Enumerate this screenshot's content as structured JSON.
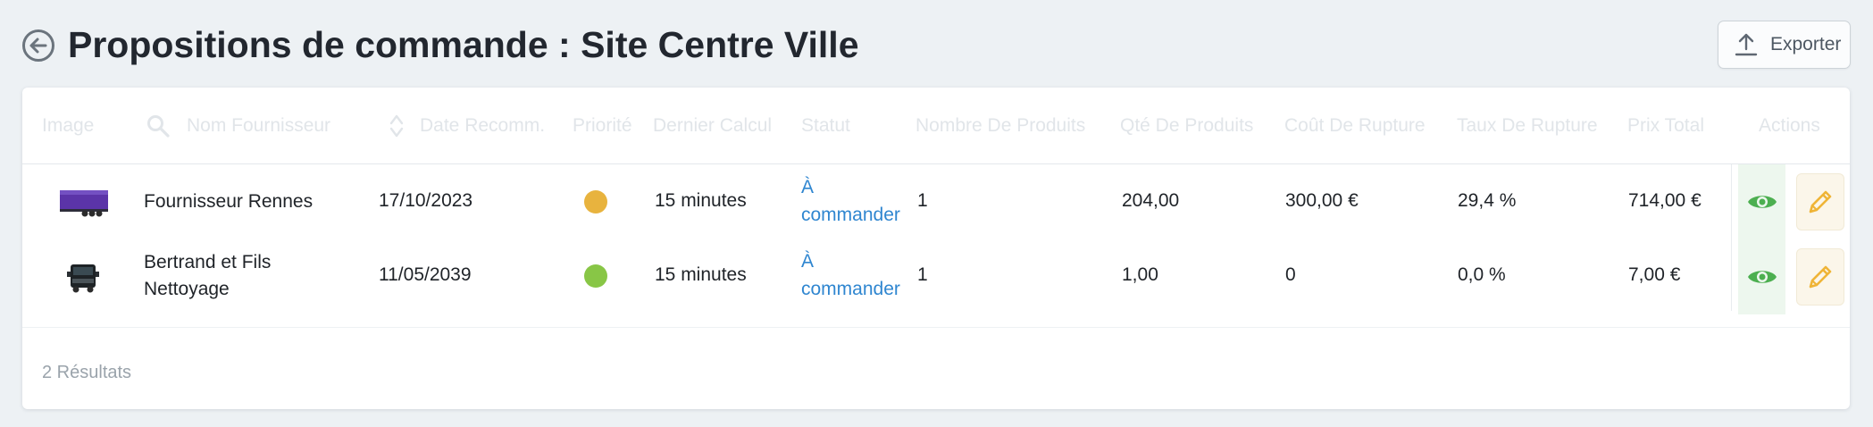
{
  "header": {
    "title": "Propositions de commande : Site Centre Ville",
    "export_label": "Exporter"
  },
  "table": {
    "columns": {
      "image": "Image",
      "search_placeholder": "Nom Fournisseur",
      "date": "Date Recomm.",
      "priority": "Priorité",
      "last_calc": "Dernier Calcul",
      "status": "Statut",
      "nb_products": "Nombre De Produits",
      "qty": "Qté De Produits",
      "rupture_cost": "Coût De Rupture",
      "rupture_rate": "Taux De Rupture",
      "total": "Prix Total",
      "actions": "Actions"
    },
    "rows": [
      {
        "supplier": "Fournisseur Rennes",
        "date": "17/10/2023",
        "priority_color": "#e8b33e",
        "last_calc": "15 minutes",
        "status": "À commander",
        "nb_products": "1",
        "qty": "204,00",
        "rupture_cost": "300,00 €",
        "rupture_rate": "29,4 %",
        "total": "714,00 €"
      },
      {
        "supplier": "Bertrand et Fils Nettoyage",
        "date": "11/05/2039",
        "priority_color": "#88c646",
        "last_calc": "15 minutes",
        "status": "À commander",
        "nb_products": "1",
        "qty": "1,00",
        "rupture_cost": "0",
        "rupture_rate": "0,0 %",
        "total": "7,00 €"
      }
    ]
  },
  "footer": {
    "results": "2 Résultats"
  },
  "colors": {
    "link": "#2f86d0",
    "view_icon": "#4caf50",
    "edit_icon": "#efb437",
    "priority_orange": "#e8b33e",
    "priority_green": "#88c646"
  },
  "icons": {
    "back": "arrow-left-circle-icon",
    "export": "upload-icon",
    "search": "search-icon",
    "sort": "sort-icon",
    "view": "eye-icon",
    "edit": "pencil-icon"
  }
}
